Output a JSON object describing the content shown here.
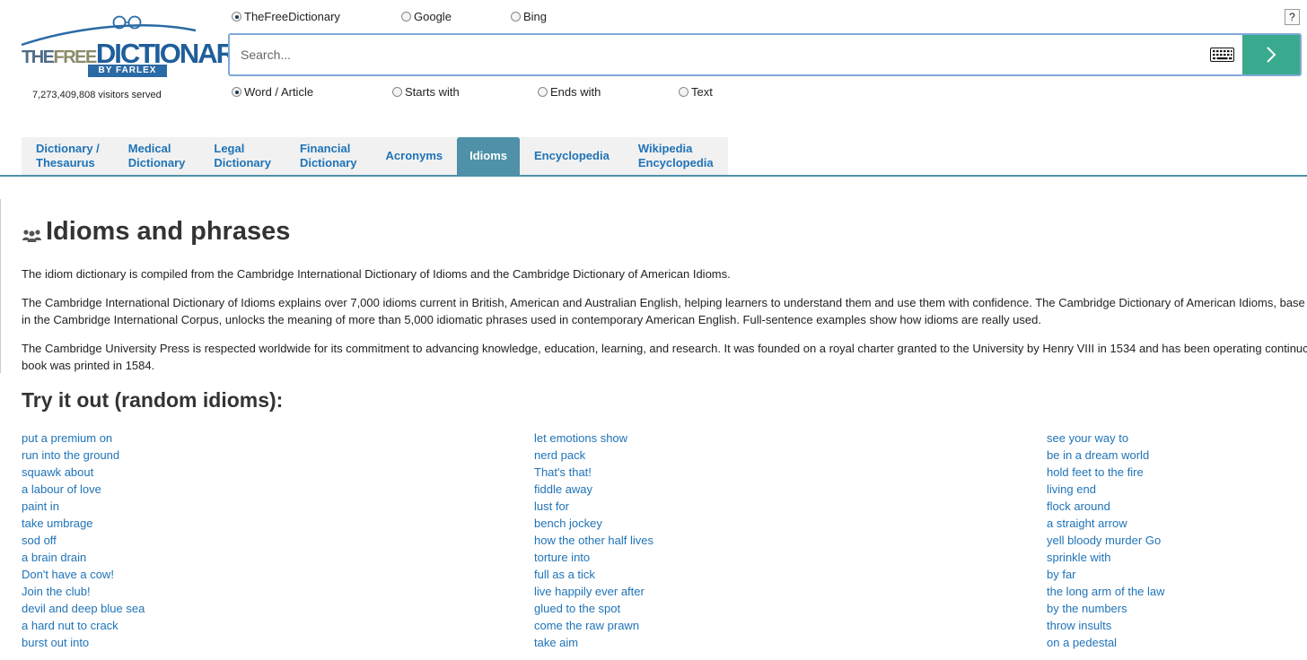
{
  "logo": {
    "the": "THE",
    "free": "FREE",
    "dictionary": "DICTIONARY",
    "byline": "BY FARLEX"
  },
  "visitors": "7,273,409,808 visitors served",
  "search_engines": [
    {
      "label": "TheFreeDictionary",
      "selected": true
    },
    {
      "label": "Google",
      "selected": false
    },
    {
      "label": "Bing",
      "selected": false
    }
  ],
  "help_label": "?",
  "search": {
    "placeholder": "Search...",
    "value": ""
  },
  "search_modes": [
    {
      "label": "Word / Article",
      "selected": true
    },
    {
      "label": "Starts with",
      "selected": false
    },
    {
      "label": "Ends with",
      "selected": false
    },
    {
      "label": "Text",
      "selected": false
    }
  ],
  "tabs": [
    {
      "line1": "Dictionary /",
      "line2": "Thesaurus",
      "active": false
    },
    {
      "line1": "Medical",
      "line2": "Dictionary",
      "active": false
    },
    {
      "line1": "Legal",
      "line2": "Dictionary",
      "active": false
    },
    {
      "line1": "Financial",
      "line2": "Dictionary",
      "active": false
    },
    {
      "line1": "Acronyms",
      "line2": "",
      "active": false
    },
    {
      "line1": "Idioms",
      "line2": "",
      "active": true
    },
    {
      "line1": "Encyclopedia",
      "line2": "",
      "active": false
    },
    {
      "line1": "Wikipedia",
      "line2": "Encyclopedia",
      "active": false
    }
  ],
  "main": {
    "title": "Idioms and phrases",
    "paragraphs": [
      [
        "The idiom dictionary is compiled from the Cambridge International Dictionary of Idioms and the Cambridge Dictionary of American Idioms."
      ],
      [
        "The Cambridge International Dictionary of Idioms explains over 7,000 idioms current in British, American and Australian English, helping learners to understand them and use them with confidence. The Cambridge Dictionary of American Idioms, base",
        "in the Cambridge International Corpus, unlocks the meaning of more than 5,000 idiomatic phrases used in contemporary American English. Full-sentence examples show how idioms are really used."
      ],
      [
        "The Cambridge University Press is respected worldwide for its commitment to advancing knowledge, education, learning, and research. It was founded on a royal charter granted to the University by Henry VIII in 1534 and has been operating continuc",
        "book was printed in 1584."
      ]
    ],
    "random_title": "Try it out (random idioms):",
    "idiom_columns": [
      [
        "put a premium on",
        "run into the ground",
        "squawk about",
        "a labour of love",
        "paint in",
        "take umbrage",
        "sod off",
        "a brain drain",
        "Don't have a cow!",
        "Join the club!",
        "devil and deep blue sea",
        "a hard nut to crack",
        "burst out into"
      ],
      [
        "let emotions show",
        "nerd pack",
        "That's that!",
        "fiddle away",
        "lust for",
        "bench jockey",
        "how the other half lives",
        "torture into",
        "full as a tick",
        "live happily ever after",
        "glued to the spot",
        "come the raw prawn",
        "take aim"
      ],
      [
        "see your way to",
        "be in a dream world",
        "hold feet to the fire",
        "living end",
        "flock around",
        "a straight arrow",
        "yell bloody murder Go",
        "sprinkle with",
        "by far",
        "the long arm of the law",
        "by the numbers",
        "throw insults",
        "on a pedestal"
      ]
    ]
  },
  "colors": {
    "link": "#1f73b7",
    "tab_active": "#4e91a8",
    "go_button": "#3aaa8e",
    "search_border": "#7fa9d8"
  },
  "icons": [
    "glasses-icon",
    "keyboard-icon",
    "chevron-right-icon",
    "people-icon"
  ]
}
